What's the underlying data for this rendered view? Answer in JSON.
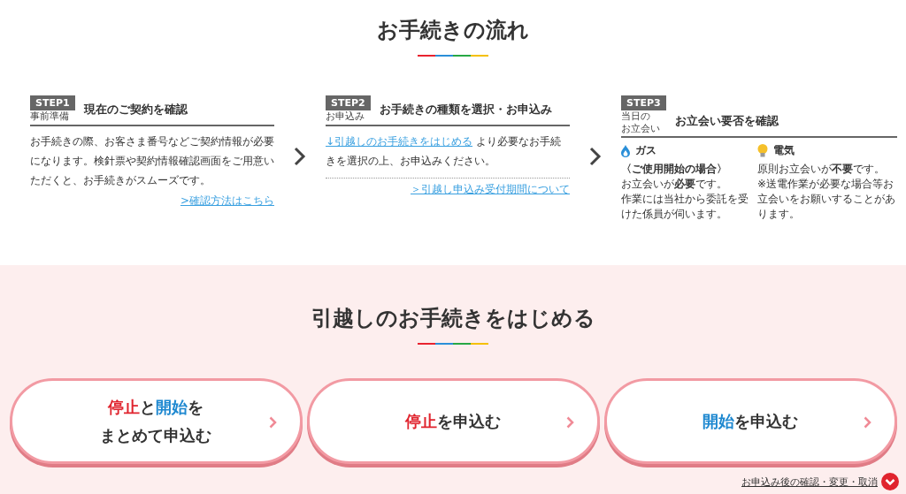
{
  "flow": {
    "title": "お手続きの流れ",
    "steps": [
      {
        "kind": "basic",
        "badge": "STEP1",
        "sub": [
          "事前準備"
        ],
        "title": "現在のご契約を確認",
        "body": "お手続きの際、お客さま番号などご契約情報が必要になります。検針票や契約情報確認画面をご用意いただくと、お手続きがスムーズです。",
        "link": ">確認方法はこちら"
      },
      {
        "kind": "apply",
        "badge": "STEP2",
        "sub": [
          "お申込み"
        ],
        "title": "お手続きの種類を選択・お申込み",
        "body_link": "↓引越しのお手続きをはじめる",
        "body": "より必要なお手続きを選択の上、お申込みください。",
        "link": "＞引越し申込み受付期間について"
      },
      {
        "kind": "visit",
        "badge": "STEP3",
        "sub": [
          "当日の",
          "お立会い"
        ],
        "title": "お立会い要否を確認",
        "gas": {
          "label": "ガス",
          "condition": "〈ご使用開始の場合〉",
          "lead": "お立会いが**必要**です。",
          "note": "作業には当社から委託を受けた係員が伺います。"
        },
        "electric": {
          "label": "電気",
          "lead": "原則お立会いが**不要**です。",
          "note": "※送電作業が必要な場合等お立会いをお願いすることがあります。"
        }
      }
    ]
  },
  "start": {
    "title": "引越しのお手続きをはじめる",
    "buttons": [
      {
        "lines": [
          [
            {
              "kind": "stop",
              "text": "停止"
            },
            {
              "kind": "plain",
              "text": "と"
            },
            {
              "kind": "start",
              "text": "開始"
            },
            {
              "kind": "plain",
              "text": "を"
            }
          ],
          [
            {
              "kind": "plain",
              "text": "まとめて申込む"
            }
          ]
        ]
      },
      {
        "lines": [
          [
            {
              "kind": "stop",
              "text": "停止"
            },
            {
              "kind": "plain",
              "text": "を申込む"
            }
          ]
        ]
      },
      {
        "lines": [
          [
            {
              "kind": "start",
              "text": "開始"
            },
            {
              "kind": "plain",
              "text": "を申込む"
            }
          ]
        ]
      }
    ],
    "footer_link": "お申込み後の確認・変更・取消"
  }
}
